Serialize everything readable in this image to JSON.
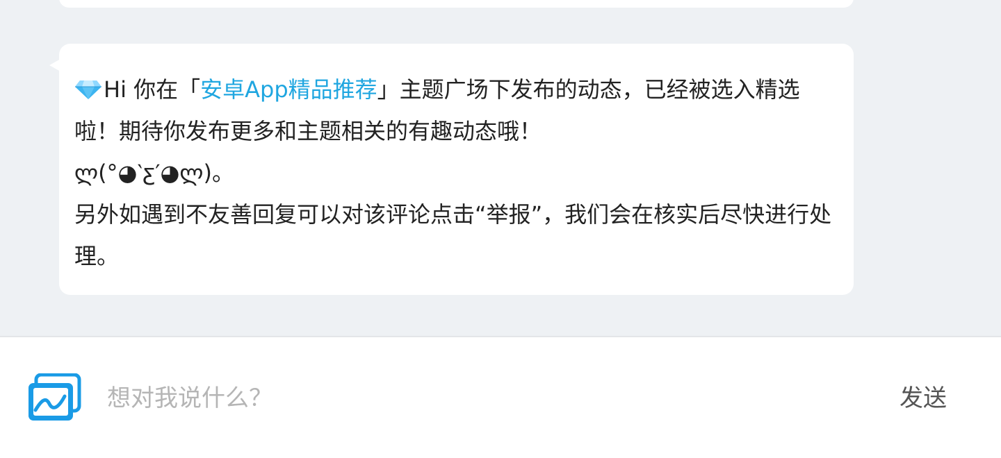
{
  "message": {
    "greeting": "Hi 你在「",
    "topic_link": "安卓App精品推荐",
    "line1_rest": "」主题广场下发布的动态，已经被选入精选啦！期待你发布更多和主题相关的有趣动态哦！",
    "kaomoji": "ლ(°◕‵ƹ′◕ლ)。",
    "line_report": "另外如遇到不友善回复可以对该评论点击“举报”，我们会在核实后尽快进行处理。",
    "icon": "gem-icon"
  },
  "composer": {
    "placeholder": "想对我说什么？",
    "value": "",
    "send_label": "发送",
    "image_icon": "image-icon"
  },
  "colors": {
    "background": "#eef1f4",
    "bubble": "#ffffff",
    "link": "#1fa6e0",
    "icon_blue": "#1a9be6"
  }
}
